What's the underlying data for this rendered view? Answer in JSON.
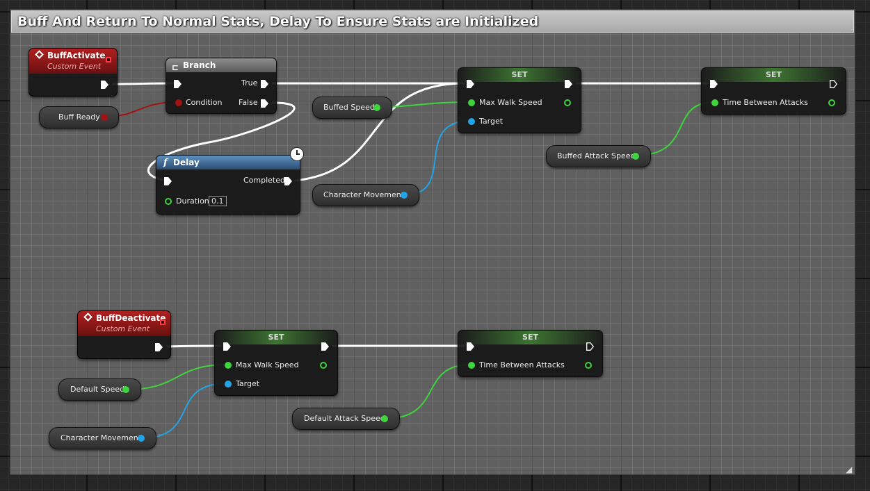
{
  "comment": {
    "title": "Buff And Return To Normal Stats, Delay To Ensure Stats are Initialized"
  },
  "nodes": {
    "buff_activate": {
      "title": "BuffActivate",
      "subtitle": "Custom Event"
    },
    "branch": {
      "title": "Branch",
      "pins": {
        "true": "True",
        "condition": "Condition",
        "false": "False"
      }
    },
    "delay": {
      "title": "Delay",
      "pins": {
        "completed": "Completed",
        "duration": "Duration"
      },
      "duration_value": "0.1"
    },
    "set_walk_speed_1": {
      "title": "SET",
      "pins": {
        "value": "Max Walk Speed",
        "target": "Target"
      }
    },
    "set_attack_1": {
      "title": "SET",
      "pins": {
        "value": "Time Between Attacks"
      }
    },
    "buff_deactivate": {
      "title": "BuffDeactivate",
      "subtitle": "Custom Event"
    },
    "set_walk_speed_2": {
      "title": "SET",
      "pins": {
        "value": "Max Walk Speed",
        "target": "Target"
      }
    },
    "set_attack_2": {
      "title": "SET",
      "pins": {
        "value": "Time Between Attacks"
      }
    }
  },
  "variables": {
    "buff_ready": "Buff Ready",
    "buffed_speed": "Buffed Speed",
    "buffed_attack_speed": "Buffed Attack Speed",
    "character_movement_1": "Character Movement",
    "default_speed": "Default Speed",
    "character_movement_2": "Character Movement",
    "default_attack_speed": "Default Attack Speed"
  },
  "colors": {
    "exec_wire": "#ffffff",
    "float_pin": "#3ed43e",
    "object_pin": "#22a4e6",
    "bool_pin": "#a31212",
    "event_header": "#b02020",
    "function_header": "#3b6a99"
  }
}
